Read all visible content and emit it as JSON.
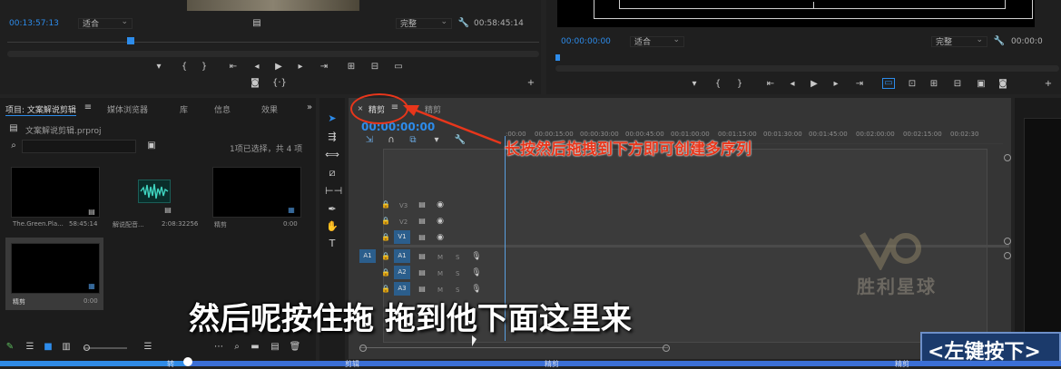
{
  "source_monitor": {
    "timecode_current": "00:13:57:13",
    "fit_select": "适合",
    "quality_select": "完整",
    "timecode_duration": "00:58:45:14"
  },
  "program_monitor": {
    "timecode_current": "00:00:00:00",
    "fit_select": "适合",
    "quality_select": "完整",
    "timecode_duration": "00:00:0"
  },
  "project_panel": {
    "tabs": [
      "项目: 文案解说剪辑",
      "媒体浏览器",
      "库",
      "信息",
      "效果"
    ],
    "project_file": "文案解说剪辑.prproj",
    "selection_status": "1项已选择，共 4 项",
    "items": [
      {
        "name": "The.Green.Pla...",
        "duration": "58:45:14"
      },
      {
        "name": "解说配音...",
        "duration": "2:08:32256"
      },
      {
        "name": "精剪",
        "duration": "0:00"
      },
      {
        "name": "精剪",
        "duration": "0:00"
      }
    ]
  },
  "timeline": {
    "tabs": [
      "精剪",
      "精剪"
    ],
    "timecode": "00:00:00:00",
    "ruler_ticks": [
      ":00:00",
      "00:00:15:00",
      "00:00:30:00",
      "00:00:45:00",
      "00:01:00:00",
      "00:01:15:00",
      "00:01:30:00",
      "00:01:45:00",
      "00:02:00:00",
      "00:02:15:00",
      "00:02:30"
    ],
    "video_tracks": [
      "V3",
      "V2",
      "V1"
    ],
    "audio_tracks": [
      "A1",
      "A2",
      "A3"
    ],
    "source_patch": "A1",
    "track_m": "M",
    "track_s": "S"
  },
  "overlay": {
    "annotation": "长按然后拖拽到下方即可创建多序列",
    "subtitle": "然后呢按住拖 拖到他下面这里来",
    "key_hint": "<左键按下>",
    "watermark": "胜利星球",
    "annotation_color": "#e8361b"
  },
  "bottom_strip": {
    "labels": [
      "转",
      "剪辑",
      "精剪",
      "精剪"
    ]
  }
}
